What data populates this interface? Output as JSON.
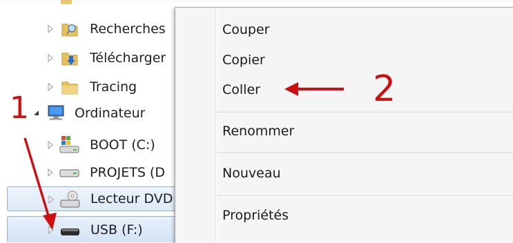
{
  "tree": {
    "items": [
      {
        "label": "Recherches"
      },
      {
        "label": "Télécharger"
      },
      {
        "label": "Tracing"
      },
      {
        "label": "Ordinateur"
      },
      {
        "label": "BOOT (C:)"
      },
      {
        "label": "PROJETS (D"
      },
      {
        "label": "Lecteur DVD"
      },
      {
        "label": "USB (F:)"
      }
    ]
  },
  "context_menu": {
    "items": [
      {
        "label": "Couper"
      },
      {
        "label": "Copier"
      },
      {
        "label": "Coller"
      },
      {
        "label": "Renommer"
      },
      {
        "label": "Nouveau"
      },
      {
        "label": "Propriétés"
      }
    ]
  },
  "annotations": {
    "step1": "1",
    "step2": "2"
  },
  "colors": {
    "annotation": "#cc1010",
    "selection": "#d3e3f4",
    "menu_bg": "#f5f5f5"
  }
}
